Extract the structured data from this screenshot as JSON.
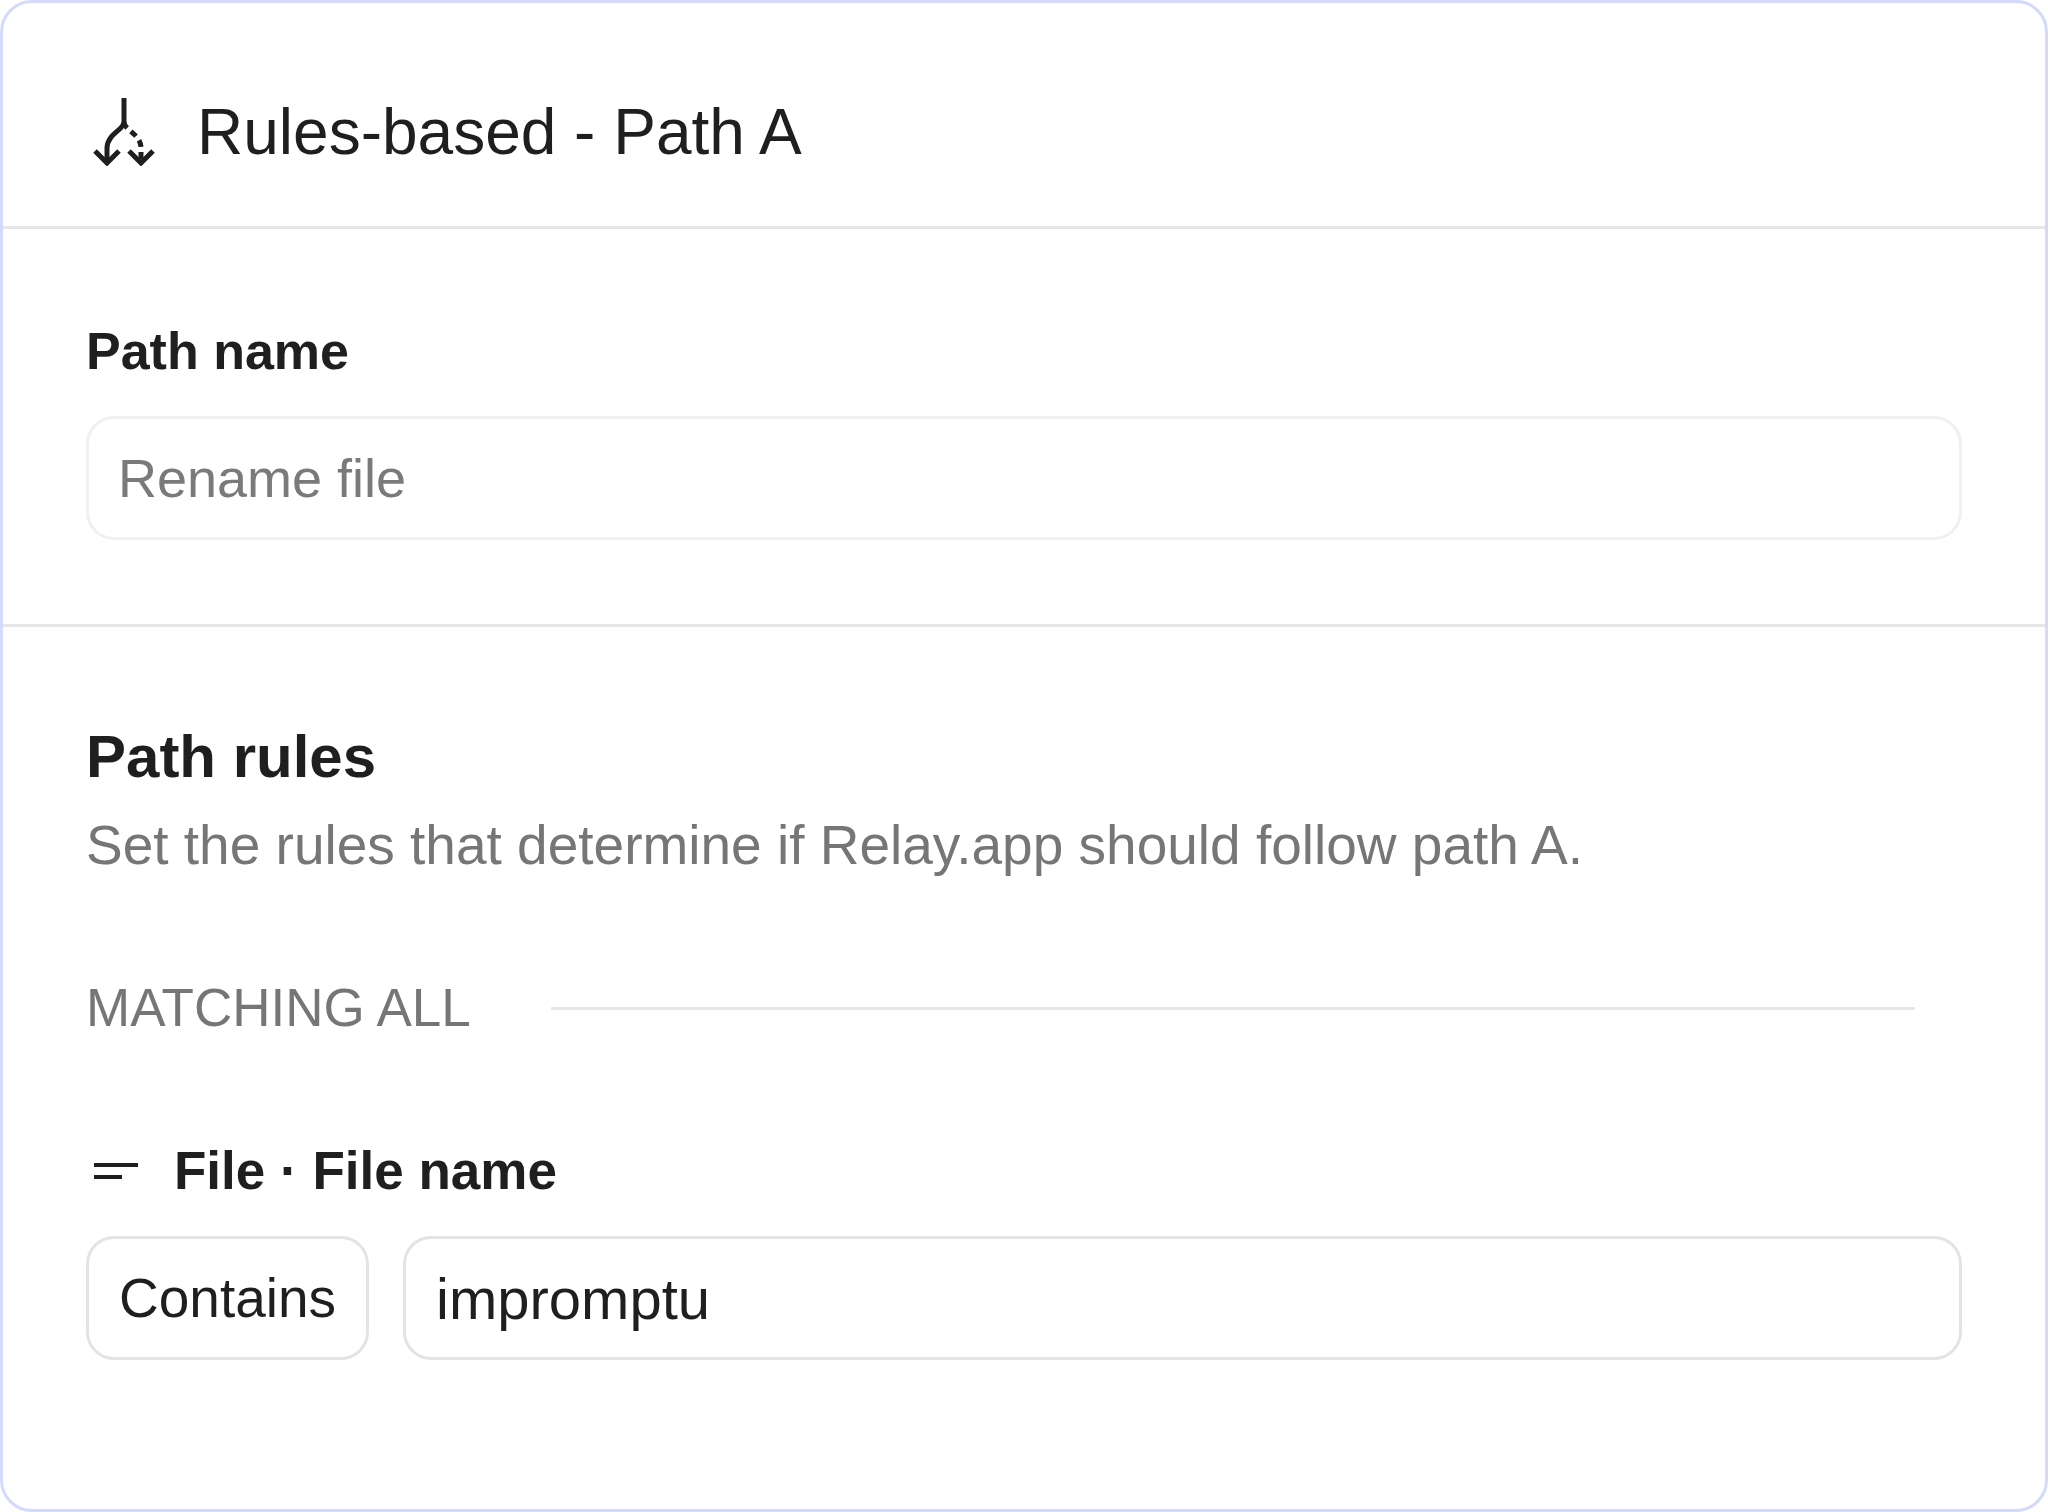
{
  "header": {
    "title": "Rules-based - Path A"
  },
  "path_name": {
    "label": "Path name",
    "placeholder": "Rename file"
  },
  "path_rules": {
    "title": "Path rules",
    "description": "Set the rules that determine if Relay.app should follow path A.",
    "match_label": "MATCHING ALL",
    "rules": [
      {
        "field": "File · File name",
        "operator": "Contains",
        "value": "impromptu"
      }
    ]
  }
}
